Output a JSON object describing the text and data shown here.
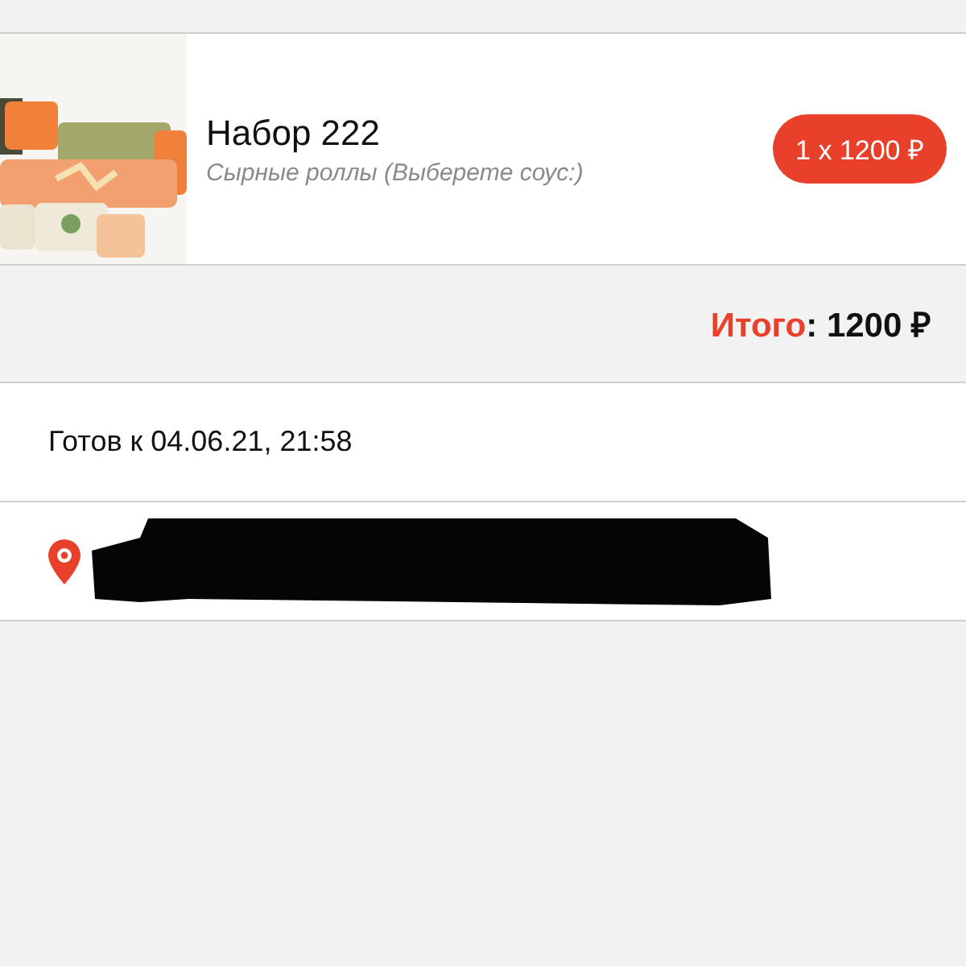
{
  "item": {
    "name": "Набор 222",
    "description": "Сырные роллы (Выберете соус:)",
    "price": "1 x 1200 ₽"
  },
  "total": {
    "label": "Итого",
    "separator": ":",
    "amount": "1200 ₽"
  },
  "ready": {
    "text": "Готов к 04.06.21, 21:58"
  },
  "address": {
    "redacted": true
  }
}
